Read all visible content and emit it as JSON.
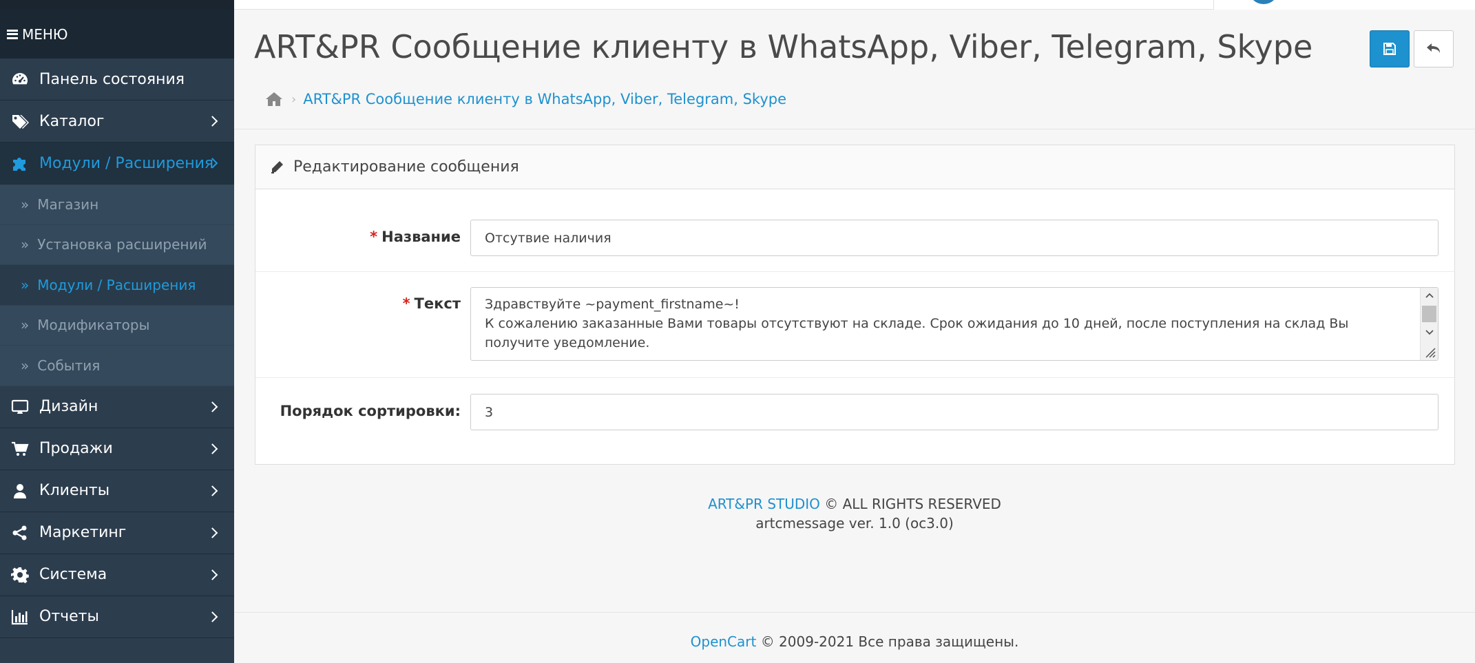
{
  "sidebar": {
    "menu_title": "МЕНЮ",
    "items": [
      {
        "label": "Панель состояния",
        "icon": "dashboard-icon"
      },
      {
        "label": "Каталог",
        "icon": "tags-icon"
      },
      {
        "label": "Модули / Расширения",
        "icon": "puzzle-icon",
        "active": true
      },
      {
        "label": "Дизайн",
        "icon": "desktop-icon"
      },
      {
        "label": "Продажи",
        "icon": "cart-icon"
      },
      {
        "label": "Клиенты",
        "icon": "user-icon"
      },
      {
        "label": "Маркетинг",
        "icon": "share-icon"
      },
      {
        "label": "Система",
        "icon": "gear-icon"
      },
      {
        "label": "Отчеты",
        "icon": "bar-chart-icon"
      }
    ],
    "submenu": [
      {
        "label": "Магазин"
      },
      {
        "label": "Установка расширений"
      },
      {
        "label": "Модули / Расширения",
        "active": true
      },
      {
        "label": "Модификаторы"
      },
      {
        "label": "События"
      }
    ]
  },
  "header": {
    "title": "ART&PR Сообщение клиенту в WhatsApp, Viber, Telegram, Skype",
    "breadcrumb": [
      "ART&PR Сообщение клиенту в WhatsApp, Viber, Telegram, Skype"
    ]
  },
  "panel": {
    "heading": "Редактирование сообщения",
    "fields": {
      "name_label": "Название",
      "name_value": "Отсутвие наличия",
      "text_label": "Текст",
      "text_value": "Здравствуйте ~payment_firstname~!\nК сожалению заказанные Вами товары отсутствуют на складе. Срок ожидания до 10 дней, после поступления на склад Вы получите уведомление.",
      "sort_label": "Порядок сортировки:",
      "sort_value": "3"
    }
  },
  "module_footer": {
    "studio_link": "ART&PR STUDIO",
    "rights": " © ALL RIGHTS RESERVED",
    "version": "artcmessage ver. 1.0 (oc3.0)"
  },
  "site_footer": {
    "link": "OpenCart",
    "text": " © 2009-2021 Все права защищены."
  },
  "colors": {
    "sidebar_bg": "#2c3d4e",
    "accent": "#1e91cf",
    "required": "#d9231a"
  }
}
